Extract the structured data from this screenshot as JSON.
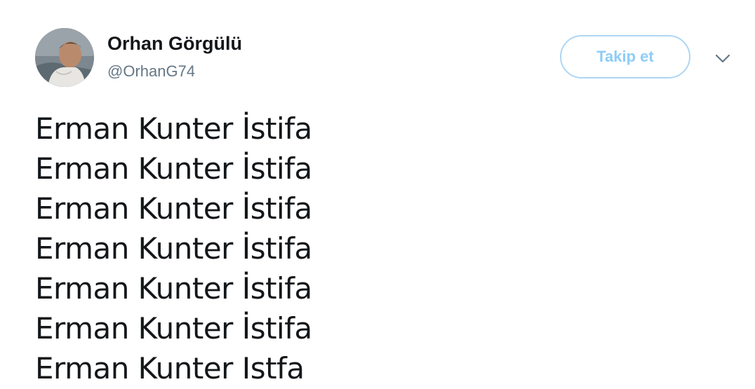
{
  "author": {
    "name": "Orhan Görgülü",
    "handle": "@OrhanG74",
    "avatar_icon": "profile-photo"
  },
  "actions": {
    "follow_label": "Takip et",
    "menu_icon": "chevron-down-icon"
  },
  "tweet": {
    "lines": [
      "Erman Kunter İstifa",
      "Erman Kunter İstifa",
      "Erman Kunter İstifa",
      "Erman Kunter İstifa",
      "Erman Kunter İstifa",
      "Erman Kunter İstifa",
      "Erman Kunter Istfa"
    ]
  },
  "colors": {
    "follow_border": "#aed6f5",
    "follow_text": "#8ecdf8",
    "name_text": "#14171a",
    "handle_text": "#657786"
  }
}
